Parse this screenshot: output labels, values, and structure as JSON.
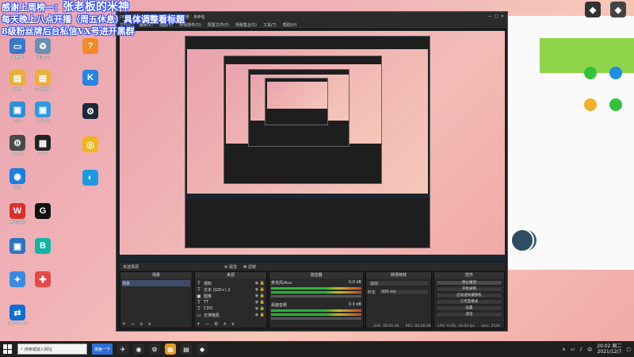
{
  "overlay": {
    "line1_a": "感谢上周榜一：",
    "line1_b": "张老板的米神",
    "line2": "每天晚上八点开播（周五休息）具体调整看标题",
    "line3": "8级粉丝牌后台私信VX号进开黑群"
  },
  "obs": {
    "title": "OBS 27.1.3 - 配置文件：未命名 - 场景：未命名",
    "menu": [
      "文件(F)",
      "编辑(E)",
      "视图(V)",
      "停靠部件(D)",
      "配置文件(P)",
      "场景集合(S)",
      "工具(T)",
      "帮助(H)"
    ],
    "status_row": {
      "label": "未选择源",
      "props": "⚙ 属性",
      "filters": "⛃ 滤镜"
    },
    "docks": {
      "scenes": {
        "header": "场景",
        "items": [
          "场景"
        ]
      },
      "sources": {
        "header": "来源",
        "items": [
          {
            "icon": "T",
            "name": "通知"
          },
          {
            "icon": "T",
            "name": "文本 (GDI+) 2"
          },
          {
            "icon": "▣",
            "name": "图像"
          },
          {
            "icon": "T",
            "name": "TT"
          },
          {
            "icon": "T",
            "name": "CDD"
          },
          {
            "icon": "▭",
            "name": "无准植机"
          }
        ]
      },
      "mixer": {
        "header": "混音器",
        "channels": [
          {
            "name": "麦克风/Aux",
            "db": "0.0 dB"
          },
          {
            "name": "桌面音频",
            "db": "0.0 dB"
          }
        ]
      },
      "transitions": {
        "header": "转场特效",
        "type": "淡出",
        "duration_label": "时长",
        "duration": "300 ms"
      },
      "controls": {
        "header": "控件",
        "buttons": [
          "停止推流",
          "开始录制",
          "启动虚拟摄像机",
          "工作室模式",
          "设置",
          "退出"
        ]
      }
    },
    "footer": {
      "live": "LIVE: 00:01:46",
      "rec": "REC: 00:00:00",
      "cpu": "CPU: 8.0%, 30.00 fps",
      "kbps": "kb/s: 2528"
    }
  },
  "taskbar": {
    "search_placeholder": "搜索或输入网址",
    "search_button": "搜索一下",
    "clock_time": "20:02 周二",
    "clock_date": "2021/12/7"
  },
  "desktop_icons": [
    "此电脑",
    "回收站",
    "网络",
    "控制面板",
    "文件",
    "QQ音乐",
    "Steam",
    "WPS",
    "微信",
    "腾讯视频",
    "TeamViewer",
    "设置"
  ],
  "colors": {
    "overlay_outline": "#2a4cff",
    "obs_bg": "#1e1e1e",
    "side_green": "#8fd44a"
  }
}
